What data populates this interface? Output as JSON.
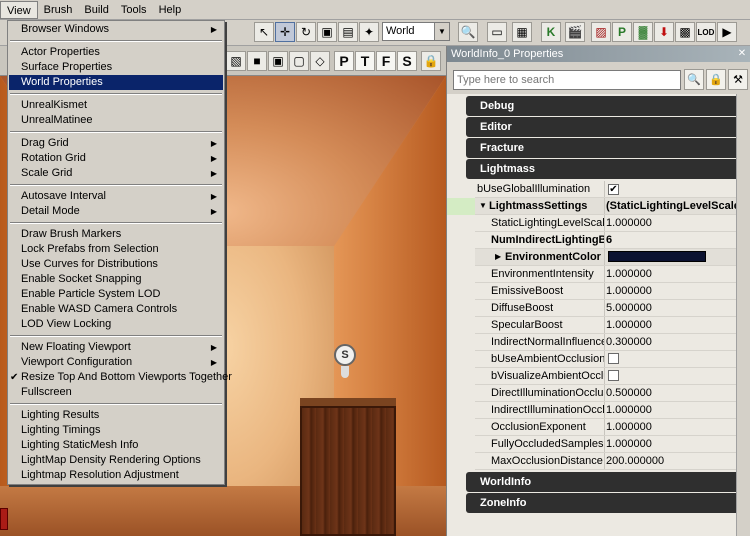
{
  "menubar": {
    "items": [
      "View",
      "Brush",
      "Build",
      "Tools",
      "Help"
    ]
  },
  "toolbar": {
    "coordinate_system": "World",
    "viewport_letters": [
      "P",
      "T",
      "F",
      "S"
    ]
  },
  "view_menu": {
    "items": [
      {
        "label": "Browser Windows",
        "submenu": true
      },
      {
        "label": "Actor Properties"
      },
      {
        "label": "Surface Properties"
      },
      {
        "label": "World Properties",
        "highlighted": true
      },
      {
        "label": "UnrealKismet"
      },
      {
        "label": "UnrealMatinee"
      },
      {
        "label": "Drag Grid",
        "submenu": true
      },
      {
        "label": "Rotation Grid",
        "submenu": true
      },
      {
        "label": "Scale Grid",
        "submenu": true
      },
      {
        "label": "Autosave Interval",
        "submenu": true
      },
      {
        "label": "Detail Mode",
        "submenu": true
      },
      {
        "label": "Draw Brush Markers"
      },
      {
        "label": "Lock Prefabs from Selection"
      },
      {
        "label": "Use Curves for Distributions"
      },
      {
        "label": "Enable Socket Snapping"
      },
      {
        "label": "Enable Particle System LOD"
      },
      {
        "label": "Enable WASD Camera Controls"
      },
      {
        "label": "LOD View Locking"
      },
      {
        "label": "New Floating Viewport",
        "submenu": true
      },
      {
        "label": "Viewport Configuration",
        "submenu": true
      },
      {
        "label": "Resize Top And Bottom Viewports Together",
        "checked": true
      },
      {
        "label": "Fullscreen"
      },
      {
        "label": "Lighting Results"
      },
      {
        "label": "Lighting Timings"
      },
      {
        "label": "Lighting StaticMesh Info"
      },
      {
        "label": "LightMap Density Rendering Options"
      },
      {
        "label": "Lightmap Resolution Adjustment"
      }
    ]
  },
  "properties": {
    "title": "WorldInfo_0 Properties",
    "search_placeholder": "Type here to search",
    "categories_top": [
      "Debug",
      "Editor",
      "Fracture",
      "Lightmass"
    ],
    "categories_bottom": [
      "WorldInfo",
      "ZoneInfo"
    ],
    "rows": [
      {
        "name": "bUseGlobalIllumination",
        "type": "checkbox",
        "checked": true
      },
      {
        "name": "LightmassSettings",
        "value": "(StaticLightingLevelScale=",
        "bold": true,
        "struct": true
      },
      {
        "name": "StaticLightingLevelScale",
        "value": "1.000000"
      },
      {
        "name": "NumIndirectLightingBo",
        "value": "6",
        "bold": true
      },
      {
        "name": "EnvironmentColor",
        "type": "color",
        "color": "#0b1230",
        "bold": true
      },
      {
        "name": "EnvironmentIntensity",
        "value": "1.000000"
      },
      {
        "name": "EmissiveBoost",
        "value": "1.000000"
      },
      {
        "name": "DiffuseBoost",
        "value": "5.000000"
      },
      {
        "name": "SpecularBoost",
        "value": "1.000000"
      },
      {
        "name": "IndirectNormalInfluenceBo",
        "value": "0.300000"
      },
      {
        "name": "bUseAmbientOcclusion",
        "type": "checkbox",
        "checked": false
      },
      {
        "name": "bVisualizeAmbientOcclusio",
        "type": "checkbox",
        "checked": false
      },
      {
        "name": "DirectIlluminationOcclusio",
        "value": "0.500000"
      },
      {
        "name": "IndirectIlluminationOcclusi",
        "value": "1.000000"
      },
      {
        "name": "OcclusionExponent",
        "value": "1.000000"
      },
      {
        "name": "FullyOccludedSamplesFrac",
        "value": "1.000000"
      },
      {
        "name": "MaxOcclusionDistance",
        "value": "200.000000"
      }
    ]
  },
  "viewport": {
    "sound_actor_letter": "S"
  },
  "colors": {
    "menu_highlight": "#0a246a",
    "category_bg": "#2f2f2f",
    "environment_color": "#0b1230"
  }
}
